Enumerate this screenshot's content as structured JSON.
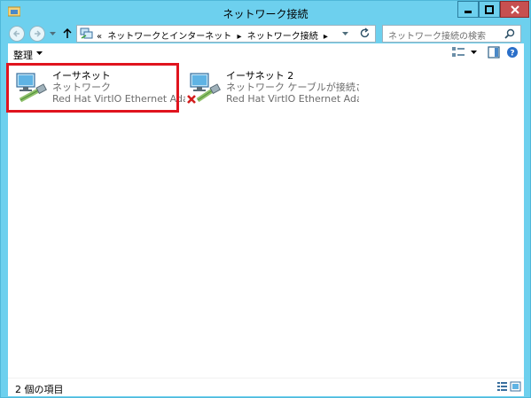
{
  "window": {
    "title": "ネットワーク接続",
    "minimize_label": "minimize",
    "maximize_label": "maximize",
    "close_label": "close"
  },
  "navigation": {
    "breadcrumb_prefix": "«",
    "breadcrumbs": [
      "ネットワークとインターネット",
      "ネットワーク接続"
    ],
    "search_placeholder": "ネットワーク接続の検索"
  },
  "toolbar": {
    "organize_label": "整理"
  },
  "items": [
    {
      "name": "イーサネット",
      "status": "ネットワーク",
      "adapter": "Red Hat VirtIO Ethernet Adap...",
      "connected": true
    },
    {
      "name": "イーサネット 2",
      "status": "ネットワーク ケーブルが接続されていま...",
      "adapter": "Red Hat VirtIO Ethernet Adap...",
      "connected": false
    }
  ],
  "statusbar": {
    "item_count": "2 個の項目"
  },
  "colors": {
    "titlebar": "#6dd0ee",
    "highlight": "#e0141e",
    "close_button": "#c75050"
  }
}
